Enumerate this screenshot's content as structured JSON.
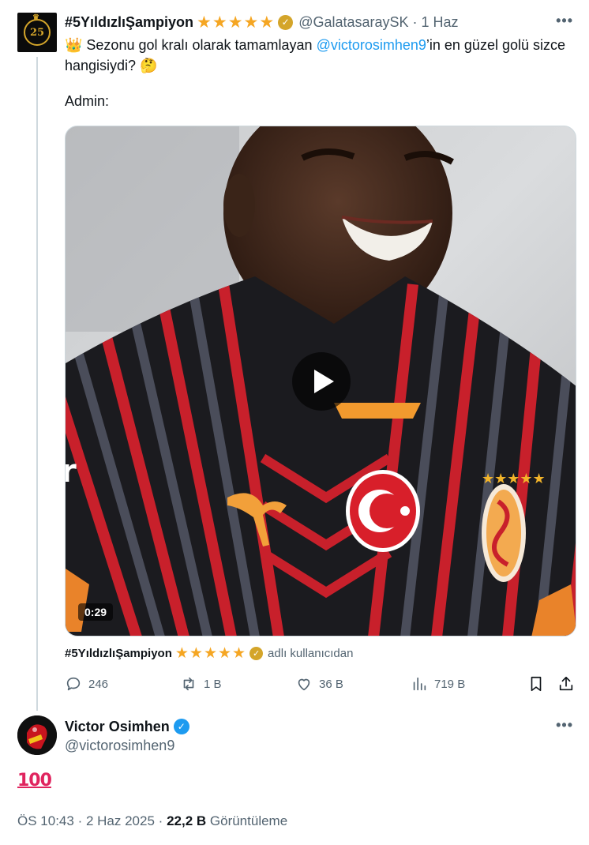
{
  "parent_tweet": {
    "author_name": "#5YıldızlıŞampiyon",
    "stars": "★★★★★",
    "handle": "@GalatasaraySK",
    "separator": "·",
    "date": "1 Haz",
    "more": "•••",
    "text_before": "👑 Sezonu gol kralı olarak tamamlayan ",
    "mention": "@victorosimhen9",
    "text_after": "’in en güzel golü sizce hangisiydi? 🤔",
    "admin": "Admin:",
    "video": {
      "duration": "0:29",
      "play_icon": "play-icon"
    },
    "attribution": {
      "name": "#5YıldızlıŞampiyon",
      "stars": "★★★★★",
      "rest": "adlı kullanıcıdan"
    },
    "actions": {
      "replies": "246",
      "reposts": "1 B",
      "likes": "36 B",
      "views": "719 B"
    },
    "avatar_badge": "25",
    "colors": {
      "gold": "#d4a52a",
      "stars": "#f5a623",
      "mention": "#1d9bf0"
    }
  },
  "reply_tweet": {
    "author_name": "Victor Osimhen",
    "handle": "@victorosimhen9",
    "more": "•••",
    "text": "100",
    "meta": {
      "time": "ÖS 10:43",
      "separator": "·",
      "date": "2 Haz 2025",
      "views": "22,2 B",
      "views_label": "Görüntüleme"
    },
    "colors": {
      "verified": "#1d9bf0"
    }
  }
}
